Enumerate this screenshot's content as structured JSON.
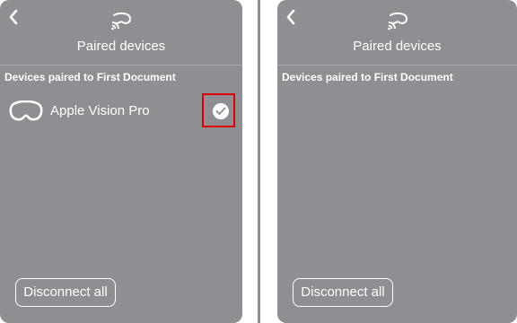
{
  "screens": [
    {
      "header": {
        "back_icon": "chevron-left-icon",
        "cast_icon": "vision-cast-icon",
        "title": "Paired devices"
      },
      "section_label": "Devices paired to First Document",
      "devices": [
        {
          "name": "Apple Vision Pro",
          "icon": "vision-pro-headset-icon",
          "selected": true
        }
      ],
      "disconnect_label": "Disconnect all"
    },
    {
      "header": {
        "back_icon": "chevron-left-icon",
        "cast_icon": "vision-cast-icon",
        "title": "Paired devices"
      },
      "section_label": "Devices paired to First Document",
      "devices": [],
      "disconnect_label": "Disconnect all"
    }
  ],
  "colors": {
    "panel_bg": "#8e8e93",
    "text": "#ffffff",
    "highlight": "#e00000"
  }
}
